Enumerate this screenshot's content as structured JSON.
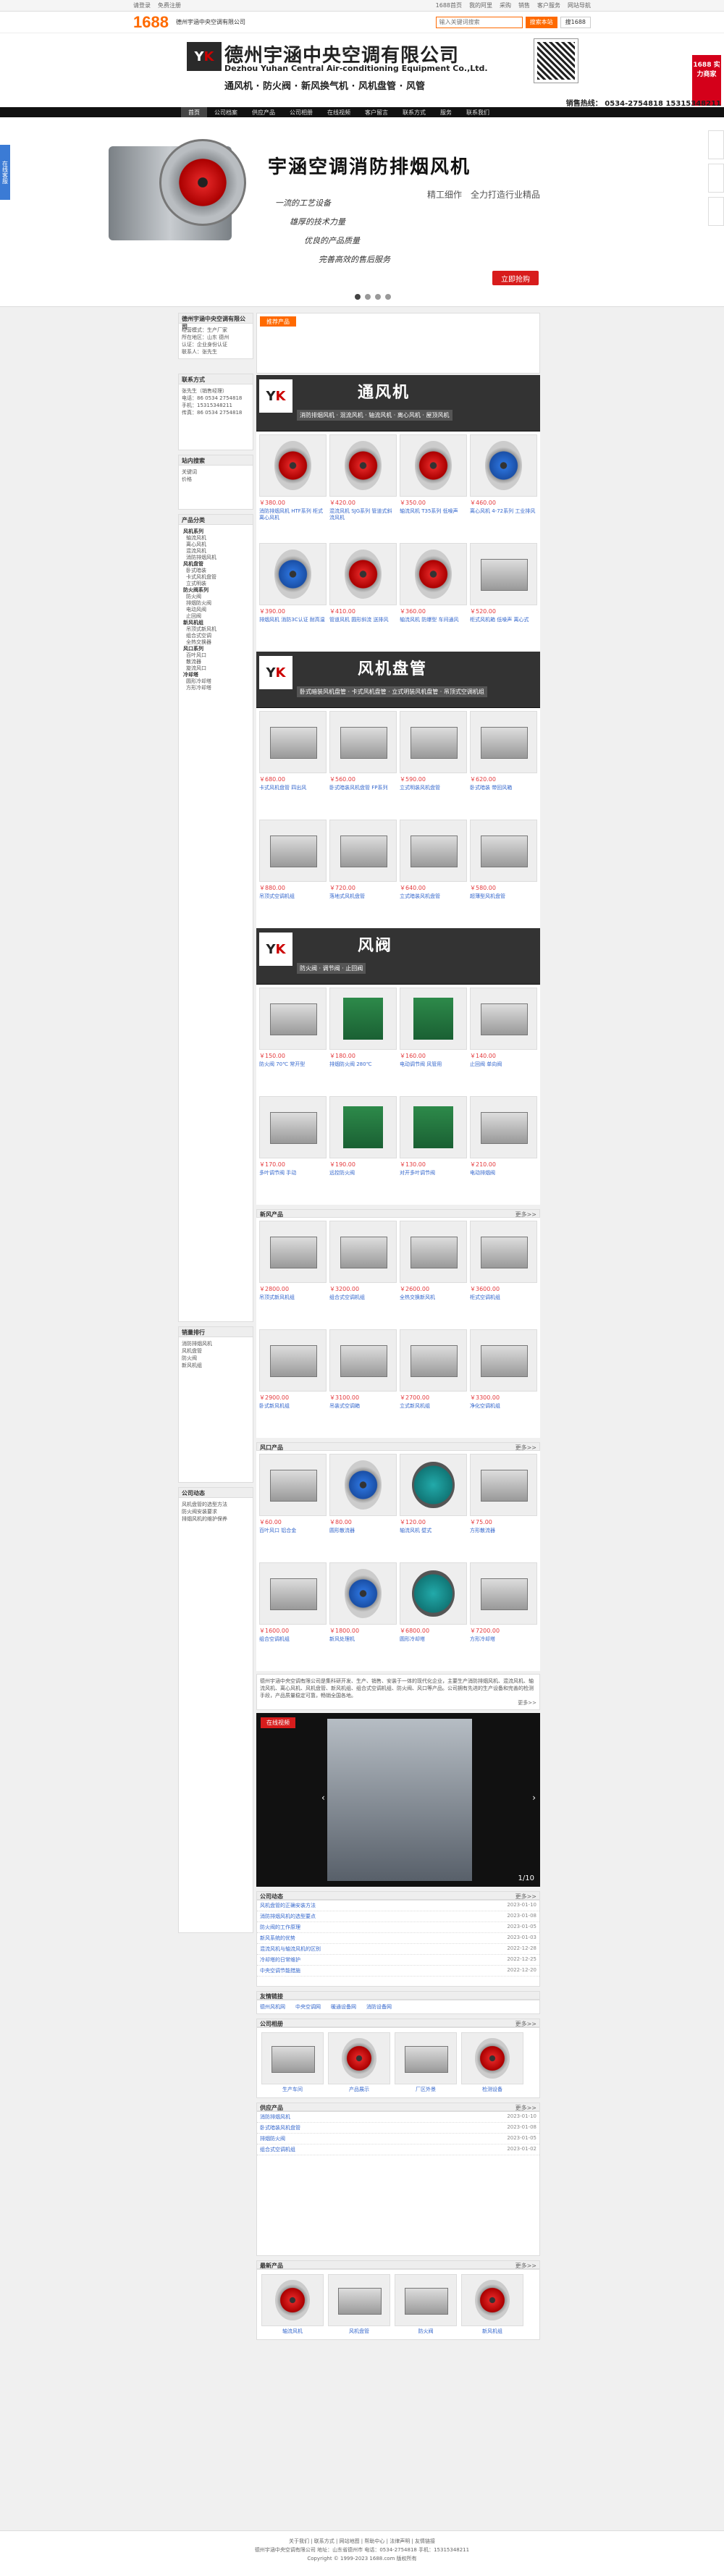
{
  "topbar": {
    "links": [
      "请登录",
      "免费注册",
      "1688首页",
      "我的阿里",
      "采购",
      "销售",
      "客户服务",
      "网站导航"
    ]
  },
  "logobar": {
    "brand": "1688",
    "shop": "德州宇涵中央空调有限公司",
    "search_placeholder": "输入关键词搜索",
    "btn_site": "搜索本站",
    "btn_1688": "搜1688"
  },
  "header": {
    "cn": "德州宇涵中央空调有限公司",
    "en": "Dezhou Yuhan Central Air-conditioning Equipment Co.,Ltd.",
    "products": "通风机 · 防火阀 · 新风换气机 · 风机盘管 · 风管",
    "hotline": "销售热线： 0534-2754818   15315348211",
    "badge": "1688 实力商家"
  },
  "nav": [
    "首页",
    "公司档案",
    "供应产品",
    "公司相册",
    "在线视频",
    "客户留言",
    "联系方式",
    "服务",
    "联系我们"
  ],
  "banner": {
    "title": "宇涵空调消防排烟风机",
    "slogan": "精工细作　全力打造行业精品",
    "lines": [
      "一流的工艺设备",
      "雄厚的技术力量",
      "优良的产品质量",
      "完善高效的售后服务"
    ],
    "button": "立即抢购"
  },
  "sidetab": "在线客服",
  "left": {
    "company": {
      "title": "德州宇涵中央空调有限公司",
      "lines": [
        "经营模式：生产厂家",
        "所在地区：山东 德州",
        "认证：企业身份认证",
        "联系人：张先生"
      ]
    },
    "contact": {
      "title": "联系方式",
      "lines": [
        "张先生（销售经理）",
        "电话：86 0534 2754818",
        "手机：15315348211",
        "传真：86 0534 2754818"
      ]
    },
    "search": {
      "title": "站内搜索",
      "lines": [
        "关键词",
        "价格"
      ]
    },
    "categories": {
      "title": "产品分类",
      "items": [
        {
          "label": "风机系列",
          "main": true
        },
        {
          "label": "轴流风机",
          "main": false
        },
        {
          "label": "离心风机",
          "main": false
        },
        {
          "label": "混流风机",
          "main": false
        },
        {
          "label": "消防排烟风机",
          "main": false
        },
        {
          "label": "风机盘管",
          "main": true
        },
        {
          "label": "卧式暗装",
          "main": false
        },
        {
          "label": "卡式风机盘管",
          "main": false
        },
        {
          "label": "立式明装",
          "main": false
        },
        {
          "label": "防火阀系列",
          "main": true
        },
        {
          "label": "防火阀",
          "main": false
        },
        {
          "label": "排烟防火阀",
          "main": false
        },
        {
          "label": "电动风阀",
          "main": false
        },
        {
          "label": "止回阀",
          "main": false
        },
        {
          "label": "新风机组",
          "main": true
        },
        {
          "label": "吊顶式新风机",
          "main": false
        },
        {
          "label": "组合式空调",
          "main": false
        },
        {
          "label": "全热交换器",
          "main": false
        },
        {
          "label": "风口系列",
          "main": true
        },
        {
          "label": "百叶风口",
          "main": false
        },
        {
          "label": "散流器",
          "main": false
        },
        {
          "label": "旋流风口",
          "main": false
        },
        {
          "label": "冷却塔",
          "main": true
        },
        {
          "label": "圆形冷却塔",
          "main": false
        },
        {
          "label": "方形冷却塔",
          "main": false
        }
      ]
    },
    "hot": {
      "title": "销量排行",
      "items": [
        "消防排烟风机",
        "风机盘管",
        "防火阀",
        "新风机组"
      ]
    },
    "news": {
      "title": "公司动态",
      "items": [
        "风机盘管的选型方法",
        "防火阀安装要求",
        "排烟风机的维护保养"
      ]
    }
  },
  "strip": {
    "tab": "推荐产品"
  },
  "sections": [
    {
      "title": "通风机",
      "sub": "消防排烟风机 · 混流风机 · 轴流风机 · 离心风机 · 屋顶风机"
    },
    {
      "title": "风机盘管",
      "sub": "卧式暗装风机盘管 · 卡式风机盘管 · 立式明装风机盘管 · 吊顶式空调机组"
    },
    {
      "title": "风阀",
      "sub": "防火阀 · 调节阀 · 止回阀"
    }
  ],
  "products_fan": [
    {
      "price": "￥380.00",
      "name": "消防排烟风机 HTF系列 柜式离心风机"
    },
    {
      "price": "￥420.00",
      "name": "混流风机 SJG系列 管道式斜流风机"
    },
    {
      "price": "￥350.00",
      "name": "轴流风机 T35系列 低噪声"
    },
    {
      "price": "￥460.00",
      "name": "离心风机 4-72系列 工业排风"
    },
    {
      "price": "￥390.00",
      "name": "排烟风机 消防3C认证 耐高温"
    },
    {
      "price": "￥410.00",
      "name": "管道风机 圆形斜流 送排风"
    },
    {
      "price": "￥360.00",
      "name": "轴流风机 防爆型 车间通风"
    },
    {
      "price": "￥520.00",
      "name": "柜式风机箱 低噪声 离心式"
    }
  ],
  "products_fcu": [
    {
      "price": "￥680.00",
      "name": "卡式风机盘管 四出风"
    },
    {
      "price": "￥560.00",
      "name": "卧式暗装风机盘管 FP系列"
    },
    {
      "price": "￥590.00",
      "name": "立式明装风机盘管"
    },
    {
      "price": "￥620.00",
      "name": "卧式暗装 带回风箱"
    },
    {
      "price": "￥880.00",
      "name": "吊顶式空调机组"
    },
    {
      "price": "￥720.00",
      "name": "落地式风机盘管"
    },
    {
      "price": "￥640.00",
      "name": "立式暗装风机盘管"
    },
    {
      "price": "￥580.00",
      "name": "超薄型风机盘管"
    }
  ],
  "products_valve": [
    {
      "price": "￥150.00",
      "name": "防火阀 70℃ 常开型"
    },
    {
      "price": "￥180.00",
      "name": "排烟防火阀 280℃"
    },
    {
      "price": "￥160.00",
      "name": "电动调节阀 风管用"
    },
    {
      "price": "￥140.00",
      "name": "止回阀 单向阀"
    },
    {
      "price": "￥170.00",
      "name": "多叶调节阀 手动"
    },
    {
      "price": "￥190.00",
      "name": "远控防火阀"
    },
    {
      "price": "￥130.00",
      "name": "对开多叶调节阀"
    },
    {
      "price": "￥210.00",
      "name": "电动排烟阀"
    }
  ],
  "new_products": {
    "title": "新风产品",
    "more": "更多>>",
    "items": [
      {
        "price": "￥2800.00",
        "name": "吊顶式新风机组"
      },
      {
        "price": "￥3200.00",
        "name": "组合式空调机组"
      },
      {
        "price": "￥2600.00",
        "name": "全热交换新风机"
      },
      {
        "price": "￥3600.00",
        "name": "柜式空调机组"
      },
      {
        "price": "￥2900.00",
        "name": "卧式新风机组"
      },
      {
        "price": "￥3100.00",
        "name": "吊装式空调箱"
      },
      {
        "price": "￥2700.00",
        "name": "立式新风机组"
      },
      {
        "price": "￥3300.00",
        "name": "净化空调机组"
      }
    ]
  },
  "other_products": {
    "title": "风口产品",
    "more": "更多>>",
    "items": [
      {
        "price": "￥60.00",
        "name": "百叶风口 铝合金"
      },
      {
        "price": "￥80.00",
        "name": "圆形散流器"
      },
      {
        "price": "￥120.00",
        "name": "轴流风机 壁式"
      },
      {
        "price": "￥75.00",
        "name": "方形散流器"
      },
      {
        "price": "￥1600.00",
        "name": "组合空调机组"
      },
      {
        "price": "￥1800.00",
        "name": "新风处理机"
      },
      {
        "price": "￥6800.00",
        "name": "圆形冷却塔"
      },
      {
        "price": "￥7200.00",
        "name": "方形冷却塔"
      }
    ]
  },
  "about": {
    "title": "公司介绍",
    "text": "德州宇涵中央空调有限公司是集科研开发、生产、销售、安装于一体的现代化企业，主要生产消防排烟风机、混流风机、轴流风机、离心风机、风机盘管、新风机组、组合式空调机组、防火阀、风口等产品。公司拥有先进的生产设备和完善的检测手段，产品质量稳定可靠，畅销全国各地。",
    "more": "更多>>"
  },
  "video": {
    "tab": "在线视频",
    "count": "1/10"
  },
  "news_table": {
    "title": "公司动态",
    "more": "更多>>",
    "rows": [
      {
        "t": "风机盘管的正确安装方法",
        "d": "2023-01-10"
      },
      {
        "t": "消防排烟风机的选型要点",
        "d": "2023-01-08"
      },
      {
        "t": "防火阀的工作原理",
        "d": "2023-01-05"
      },
      {
        "t": "新风系统的优势",
        "d": "2023-01-03"
      },
      {
        "t": "混流风机与轴流风机的区别",
        "d": "2022-12-28"
      },
      {
        "t": "冷却塔的日常维护",
        "d": "2022-12-25"
      },
      {
        "t": "中央空调节能措施",
        "d": "2022-12-20"
      }
    ]
  },
  "friend_links": {
    "title": "友情链接",
    "items": [
      "德州风机网",
      "中央空调网",
      "暖通设备网",
      "消防设备网"
    ]
  },
  "album": {
    "title": "公司相册",
    "more": "更多>>",
    "items": [
      "生产车间",
      "产品展示",
      "厂区外景",
      "检测设备"
    ]
  },
  "cases": {
    "title": "供应产品",
    "more": "更多>>",
    "rows": [
      {
        "t": "消防排烟风机",
        "d": "2023-01-10"
      },
      {
        "t": "卧式暗装风机盘管",
        "d": "2023-01-08"
      },
      {
        "t": "排烟防火阀",
        "d": "2023-01-05"
      },
      {
        "t": "组合式空调机组",
        "d": "2023-01-02"
      }
    ]
  },
  "recent": {
    "title": "最新产品",
    "more": "更多>>",
    "items": [
      "轴流风机",
      "风机盘管",
      "防火阀",
      "新风机组"
    ]
  },
  "footer": {
    "l1": "关于我们 | 联系方式 | 网站地图 | 帮助中心 | 法律声明 | 友情链接",
    "l2": "德州宇涵中央空调有限公司  地址：山东省德州市  电话：0534-2754818  手机：15315348211",
    "l3": "Copyright © 1999-2023 1688.com 版权所有"
  }
}
